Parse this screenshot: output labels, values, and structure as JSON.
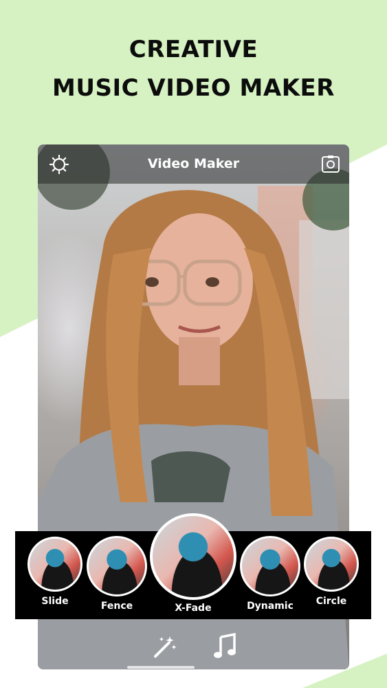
{
  "headline": {
    "line1": "CREATIVE",
    "line2": "MUSIC VIDEO MAKER"
  },
  "appbar": {
    "title": "Video Maker",
    "left_icon": "settings-gear-icon",
    "right_icon": "camera-switch-icon"
  },
  "transitions": [
    {
      "label": "Slide"
    },
    {
      "label": "Fence"
    },
    {
      "label": "X-Fade",
      "selected": true
    },
    {
      "label": "Dynamic"
    },
    {
      "label": "Circle"
    }
  ],
  "toolbar": {
    "left_icon": "magic-wand-icon",
    "right_icon": "music-note-icon"
  },
  "colors": {
    "green": "#d6f2c2",
    "accent_teal": "#2f8fb3",
    "bar_bg": "#000000"
  }
}
